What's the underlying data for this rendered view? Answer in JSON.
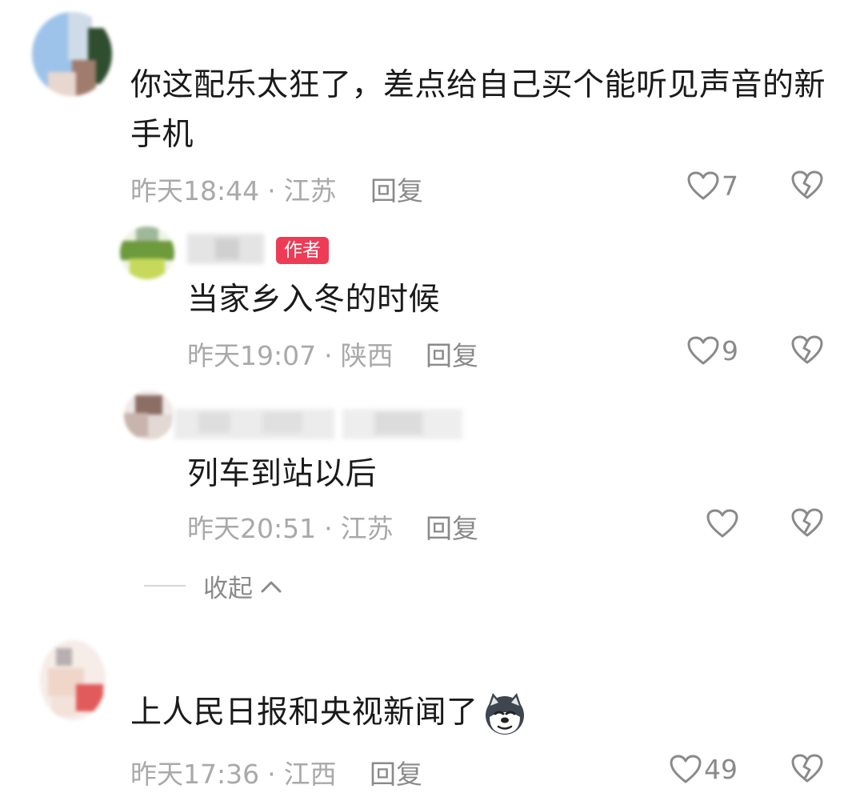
{
  "comments": [
    {
      "text": "你这配乐太狂了，差点给自己买个能听见声音的新手机",
      "time": "昨天18:44",
      "location": "江苏",
      "reply_label": "回复",
      "likes": "7"
    },
    {
      "author_badge": "作者",
      "text": "当家乡入冬的时候",
      "time": "昨天19:07",
      "location": "陕西",
      "reply_label": "回复",
      "likes": "9"
    },
    {
      "text": "列车到站以后",
      "time": "昨天20:51",
      "location": "江苏",
      "reply_label": "回复",
      "likes": ""
    },
    {
      "text": "上人民日报和央视新闻了",
      "time": "昨天17:36",
      "location": "江西",
      "reply_label": "回复",
      "likes": "49"
    }
  ],
  "separator": "·",
  "collapse_label": "收起",
  "icons": {
    "like": "heart-outline-icon",
    "dislike": "broken-heart-icon",
    "collapse": "chevron-up-icon",
    "emoji": "husky-emoji-icon"
  },
  "colors": {
    "badge": "#ee3b56",
    "meta": "#a9a9a9",
    "text": "#1a1a1a"
  }
}
